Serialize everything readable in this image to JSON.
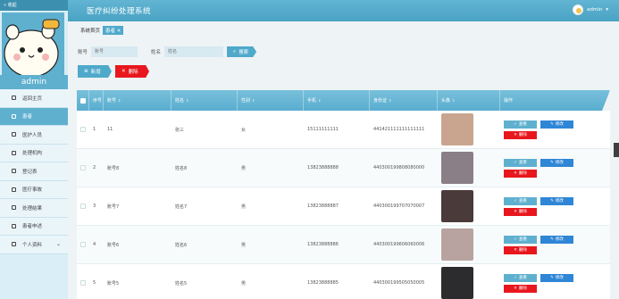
{
  "header": {
    "collapse_label": "« 收起",
    "title": "医疗纠纷处理系统",
    "user": "admin",
    "user_caret": "▾"
  },
  "sidebar": {
    "admin_name": "admin",
    "items": [
      {
        "label": "返回主页",
        "icon": "home-icon"
      },
      {
        "label": "患者",
        "icon": "chat-icon",
        "active": true
      },
      {
        "label": "医护人员",
        "icon": "send-icon"
      },
      {
        "label": "处理机构",
        "icon": "grid-icon"
      },
      {
        "label": "登记表",
        "icon": "file-icon"
      },
      {
        "label": "医疗事故",
        "icon": "grid-icon"
      },
      {
        "label": "处理结果",
        "icon": "grid-icon"
      },
      {
        "label": "患者申述",
        "icon": "file-icon"
      },
      {
        "label": "个人资料",
        "icon": "calendar-icon",
        "chevron": "⌄"
      }
    ]
  },
  "breadcrumb": {
    "home": "系统首页",
    "current": "患者",
    "close": "✕"
  },
  "search": {
    "account_label": "账号",
    "account_placeholder": "账号",
    "name_label": "姓名",
    "name_placeholder": "姓名",
    "button": "搜索"
  },
  "actions": {
    "add": "新增",
    "delete": "删除"
  },
  "table": {
    "headers": {
      "index": "序号",
      "account": "账号",
      "name": "姓名",
      "sex": "性别",
      "phone": "手机",
      "idcard": "身份证",
      "photo": "头像",
      "ops": "操作"
    },
    "sort_glyph": "⇕",
    "rows": [
      {
        "index": "1",
        "account": "11",
        "name": "张三",
        "sex": "女",
        "phone": "15111111111",
        "idcard": "441421111111111111",
        "photo_color": "#c9a58f"
      },
      {
        "index": "2",
        "account": "账号8",
        "name": "姓名8",
        "sex": "男",
        "phone": "13823888888",
        "idcard": "440300199808080000",
        "photo_color": "#8a7f86"
      },
      {
        "index": "3",
        "account": "账号7",
        "name": "姓名7",
        "sex": "男",
        "phone": "13823888887",
        "idcard": "440300199707070007",
        "photo_color": "#4a3a3a"
      },
      {
        "index": "4",
        "account": "账号6",
        "name": "姓名6",
        "sex": "男",
        "phone": "13823888886",
        "idcard": "440300199606060006",
        "photo_color": "#b9a3a0"
      },
      {
        "index": "5",
        "account": "账号5",
        "name": "姓名5",
        "sex": "男",
        "phone": "13823888885",
        "idcard": "440300199505050005",
        "photo_color": "#2c2c2e"
      }
    ],
    "op_labels": {
      "view": "查看",
      "edit": "修改",
      "delete": "删除"
    }
  },
  "colors": {
    "accent": "#4fa9cb",
    "danger": "#e8171d",
    "edit": "#2f86d6"
  }
}
